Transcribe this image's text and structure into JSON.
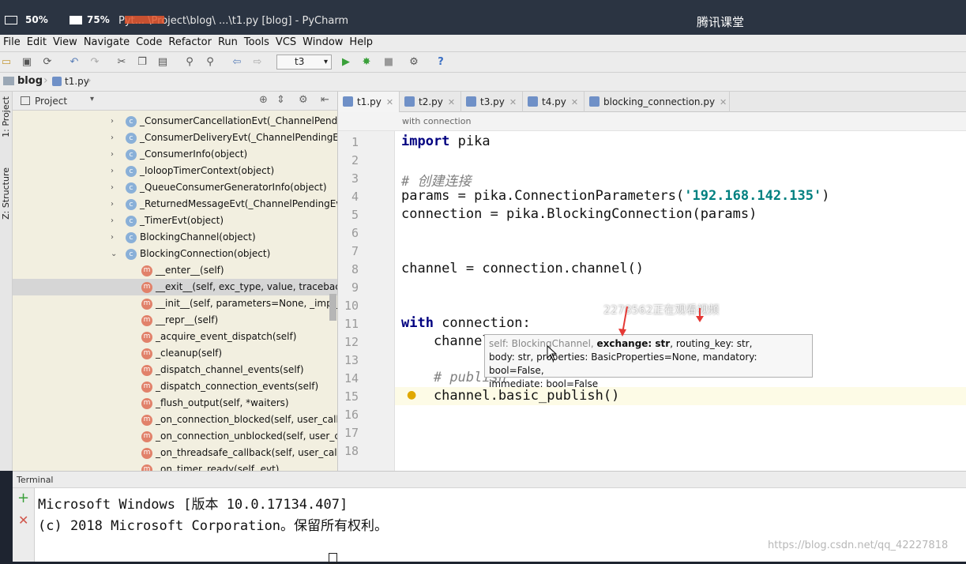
{
  "titlebar": {
    "battery": "50%",
    "volume": "75%",
    "title": "Pyt... \\Project\\blog\\ ...\\t1.py [blog] - PyCharm",
    "brand": "腾讯课堂"
  },
  "menu": [
    "File",
    "Edit",
    "View",
    "Navigate",
    "Code",
    "Refactor",
    "Run",
    "Tools",
    "VCS",
    "Window",
    "Help"
  ],
  "toolbar": {
    "run_config": "t3"
  },
  "navbar": {
    "project": "blog",
    "file": "t1.py"
  },
  "left_stripe": {
    "project_tab": "1: Project",
    "structure_tab": "Z: Structure"
  },
  "project_pane": {
    "header": "Project",
    "rows": [
      {
        "label": "_ConsumerCancellationEvt(_ChannelPendingEvt)",
        "kind": "class",
        "arrow": "›"
      },
      {
        "label": "_ConsumerDeliveryEvt(_ChannelPendingEvt)",
        "kind": "class",
        "arrow": "›"
      },
      {
        "label": "_ConsumerInfo(object)",
        "kind": "class",
        "arrow": "›"
      },
      {
        "label": "_IoloopTimerContext(object)",
        "kind": "class",
        "arrow": "›"
      },
      {
        "label": "_QueueConsumerGeneratorInfo(object)",
        "kind": "class",
        "arrow": "›"
      },
      {
        "label": "_ReturnedMessageEvt(_ChannelPendingEvt)",
        "kind": "class",
        "arrow": "›"
      },
      {
        "label": "_TimerEvt(object)",
        "kind": "class",
        "arrow": "›"
      },
      {
        "label": "BlockingChannel(object)",
        "kind": "class",
        "arrow": "›"
      },
      {
        "label": "BlockingConnection(object)",
        "kind": "class",
        "arrow": "⌄"
      },
      {
        "label": "__enter__(self)",
        "kind": "method"
      },
      {
        "label": "__exit__(self, exc_type, value, traceback)",
        "kind": "method",
        "selected": true
      },
      {
        "label": "__init__(self, parameters=None, _impl_class=None)",
        "kind": "method"
      },
      {
        "label": "__repr__(self)",
        "kind": "method"
      },
      {
        "label": "_acquire_event_dispatch(self)",
        "kind": "method"
      },
      {
        "label": "_cleanup(self)",
        "kind": "method"
      },
      {
        "label": "_dispatch_channel_events(self)",
        "kind": "method"
      },
      {
        "label": "_dispatch_connection_events(self)",
        "kind": "method"
      },
      {
        "label": "_flush_output(self, *waiters)",
        "kind": "method"
      },
      {
        "label": "_on_connection_blocked(self, user_callback)",
        "kind": "method"
      },
      {
        "label": "_on_connection_unblocked(self, user_callback)",
        "kind": "method"
      },
      {
        "label": "_on_threadsafe_callback(self, user_callback)",
        "kind": "method"
      },
      {
        "label": "_on_timer_ready(self, evt)",
        "kind": "method"
      }
    ]
  },
  "tabs": [
    "t1.py",
    "t2.py",
    "t3.py",
    "t4.py",
    "blocking_connection.py"
  ],
  "editor": {
    "breadcrumb": "with connection",
    "line_numbers": [
      "1",
      "2",
      "3",
      "4",
      "5",
      "6",
      "7",
      "8",
      "9",
      "10",
      "11",
      "12",
      "13",
      "14",
      "15",
      "16",
      "17",
      "18"
    ],
    "lines": {
      "l1_kw": "import",
      "l1_rest": " pika",
      "l3": "# 创建连接",
      "l4_a": "params = pika.ConnectionParameters(",
      "l4_str": "'192.168.142.135'",
      "l4_b": ")",
      "l5": "connection = pika.BlockingConnection(params)",
      "l8": "channel = connection.channel()",
      "l11_kw": "with",
      "l11_rest": " connection:",
      "l12": "    channel.",
      "l14": "    # publish",
      "l15": "    channel.basic_publish()"
    }
  },
  "tooltip": {
    "self_part": "self: BlockingChannel, ",
    "bold_part": "exchange: str",
    "rest1": ", routing_key: str,",
    "line2": "body: str, properties: BasicProperties=None, mandatory: bool=False,",
    "line3": "immediate: bool=False"
  },
  "overlay_notice": "2278562正在观看视频",
  "terminal": {
    "label": "Terminal",
    "line1": "Microsoft Windows [版本 10.0.17134.407]",
    "line2": "(c) 2018 Microsoft Corporation。保留所有权利。"
  },
  "watermark": "https://blog.csdn.net/qq_42227818",
  "colors": {
    "keyword": "#000080",
    "string": "#008080",
    "comment": "#808080",
    "arrow_red": "#e53935"
  }
}
